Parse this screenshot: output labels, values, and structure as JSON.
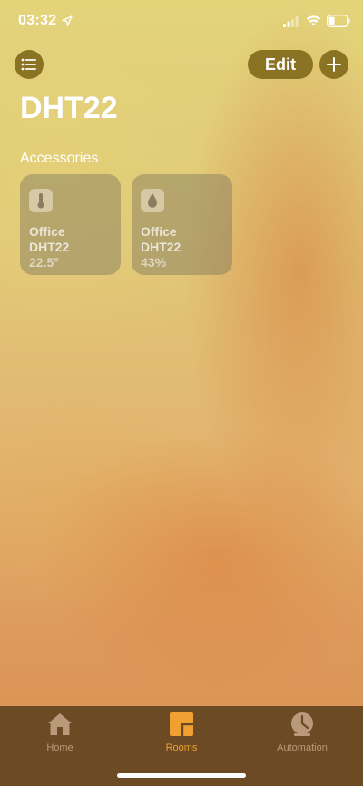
{
  "status_bar": {
    "time": "03:32",
    "icons": [
      "location-arrow-icon",
      "signal-icon",
      "wifi-icon",
      "battery-icon"
    ]
  },
  "header": {
    "edit_label": "Edit",
    "menu_icon": "list-icon",
    "add_icon": "plus-icon",
    "title": "DHT22"
  },
  "accessories": {
    "section_title": "Accessories",
    "tiles": [
      {
        "room": "Office",
        "name": "DHT22",
        "value": "22.5°",
        "icon": "thermometer-icon"
      },
      {
        "room": "Office",
        "name": "DHT22",
        "value": "43%",
        "icon": "droplet-icon"
      }
    ]
  },
  "tab_bar": {
    "tabs": [
      {
        "label": "Home",
        "icon": "house-icon",
        "active": false
      },
      {
        "label": "Rooms",
        "icon": "rooms-icon",
        "active": true
      },
      {
        "label": "Automation",
        "icon": "clock-icon",
        "active": false
      }
    ]
  },
  "colors": {
    "accent_button": "#8a7322",
    "tab_bar_bg": "#6b4a24",
    "tab_active": "#f0a030",
    "tab_inactive": "#b89a7a"
  }
}
